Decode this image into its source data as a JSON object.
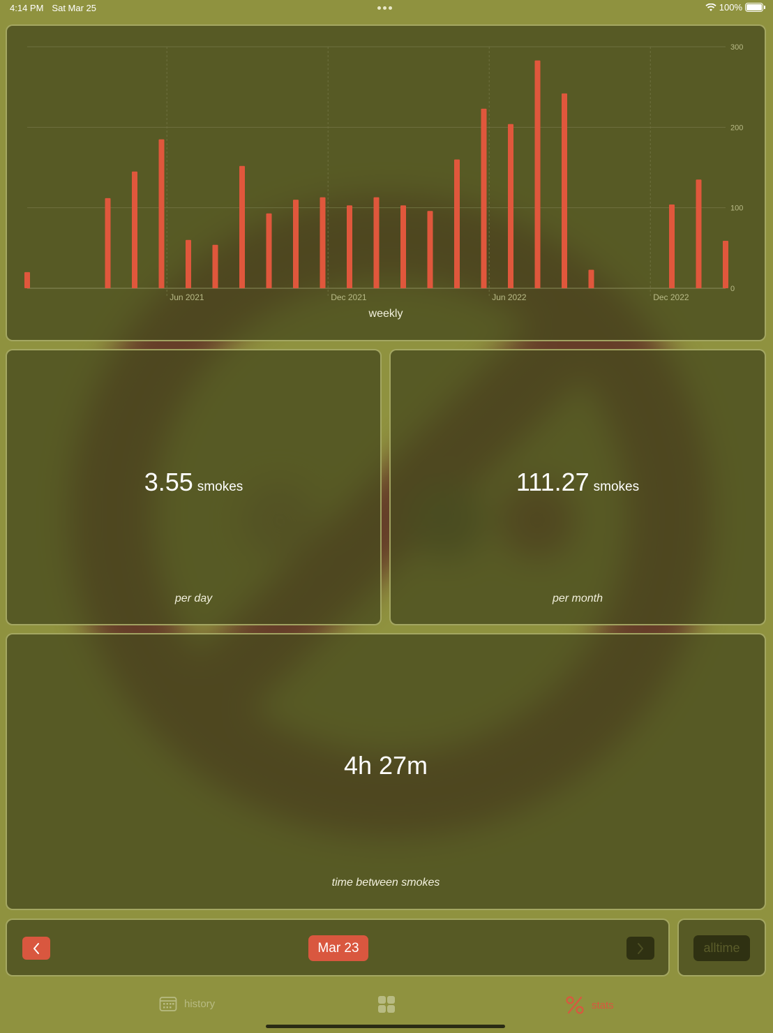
{
  "status_bar": {
    "time": "4:14 PM",
    "date": "Sat Mar 25",
    "battery": "100%",
    "icons": [
      "wifi-icon",
      "battery-icon",
      "multitasking-dots-icon"
    ]
  },
  "chart_data": {
    "type": "bar",
    "title": "",
    "caption": "weekly",
    "xlabel": "",
    "ylabel": "",
    "ylim": [
      0,
      300
    ],
    "y_ticks": [
      "0",
      "100",
      "200",
      "300"
    ],
    "x_tick_labels": [
      "Jun 2021",
      "Dec 2021",
      "Jun 2022",
      "Dec 2022"
    ],
    "values": [
      20,
      0,
      0,
      112,
      145,
      185,
      60,
      54,
      152,
      93,
      110,
      113,
      103,
      113,
      103,
      96,
      160,
      223,
      204,
      283,
      242,
      23,
      0,
      0,
      104,
      135,
      59
    ],
    "bar_color": "#e0573c",
    "grid": true
  },
  "stats": {
    "per_day": {
      "value": "3.55",
      "unit": "smokes",
      "caption": "per day"
    },
    "per_month": {
      "value": "111.27",
      "unit": "smokes",
      "caption": "per month"
    },
    "between": {
      "value": "4h 27m",
      "caption": "time between smokes"
    }
  },
  "navigation": {
    "current_date": "Mar 23",
    "alltime_label": "alltime",
    "prev_icon": "chevron-left-icon",
    "next_icon": "chevron-right-icon"
  },
  "tabs": [
    {
      "label": "history",
      "icon": "calendar-icon"
    },
    {
      "label": "",
      "icon": "grid-icon"
    },
    {
      "label": "stats",
      "icon": "percent-icon"
    }
  ],
  "colors": {
    "background": "#8f923f",
    "card": "#4b4c22",
    "accent": "#d9573f",
    "dark_button": "#2f3112"
  }
}
